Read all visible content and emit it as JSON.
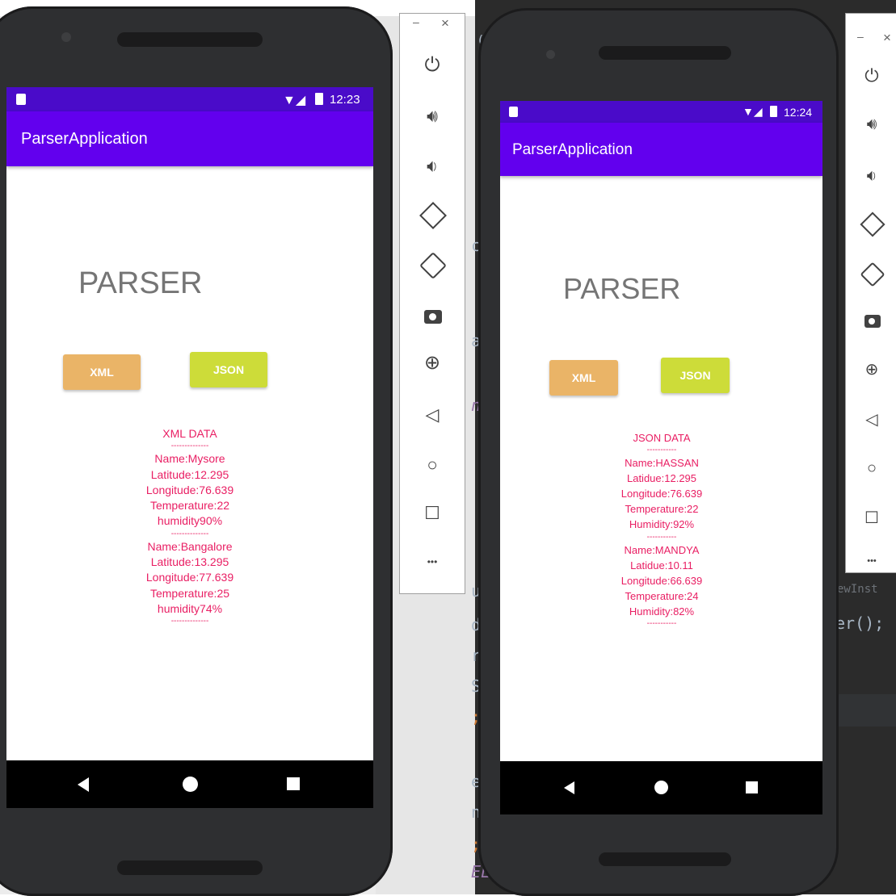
{
  "ide_background": {
    "left_code_fragments": [],
    "right_code_fragments": {
      "c1": "ct",
      "c2": "ar",
      "c3": "n)",
      "c4": "ui",
      "c5": "d(",
      "c6": "r",
      "c7": "St",
      "c8": ";",
      "c9": "er",
      "c10": "n(",
      "c11": ";",
      "c12": "EL",
      "call": "er();",
      "top_tab": "( AI",
      "newinst": "ewInst"
    }
  },
  "emulators": [
    {
      "status": {
        "time": "12:23"
      },
      "app_title": "ParserApplication",
      "heading": "PARSER",
      "buttons": {
        "xml": "XML",
        "json": "JSON"
      },
      "data": {
        "title": "XML DATA",
        "separator": "--------------",
        "records": [
          {
            "name": "Name:Mysore",
            "lat": "Latitude:12.295",
            "lon": "Longitude:76.639",
            "temp": "Temperature:22",
            "hum": "humidity90%"
          },
          {
            "name": "Name:Bangalore",
            "lat": "Latitude:13.295",
            "lon": "Longitude:77.639",
            "temp": "Temperature:25",
            "hum": "humidity74%"
          }
        ]
      }
    },
    {
      "status": {
        "time": "12:24"
      },
      "app_title": "ParserApplication",
      "heading": "PARSER",
      "buttons": {
        "xml": "XML",
        "json": "JSON"
      },
      "data": {
        "title": "JSON DATA",
        "separator": "-----------",
        "records": [
          {
            "name": "Name:HASSAN",
            "lat": "Latidue:12.295",
            "lon": "Longitude:76.639",
            "temp": "Temperature:22",
            "hum": "Humidity:92%"
          },
          {
            "name": "Name:MANDYA",
            "lat": "Latidue:10.11",
            "lon": "Longitude:66.639",
            "temp": "Temperature:24",
            "hum": "Humidity:82%"
          }
        ]
      }
    }
  ],
  "toolbar": {
    "minimize": "–",
    "close": "×",
    "icons": [
      "power-icon",
      "volume-up-icon",
      "volume-down-icon",
      "rotate-left-icon",
      "rotate-right-icon",
      "camera-icon",
      "zoom-icon",
      "back-icon",
      "home-icon",
      "overview-icon",
      "more-icon"
    ],
    "more_label": "•••"
  }
}
